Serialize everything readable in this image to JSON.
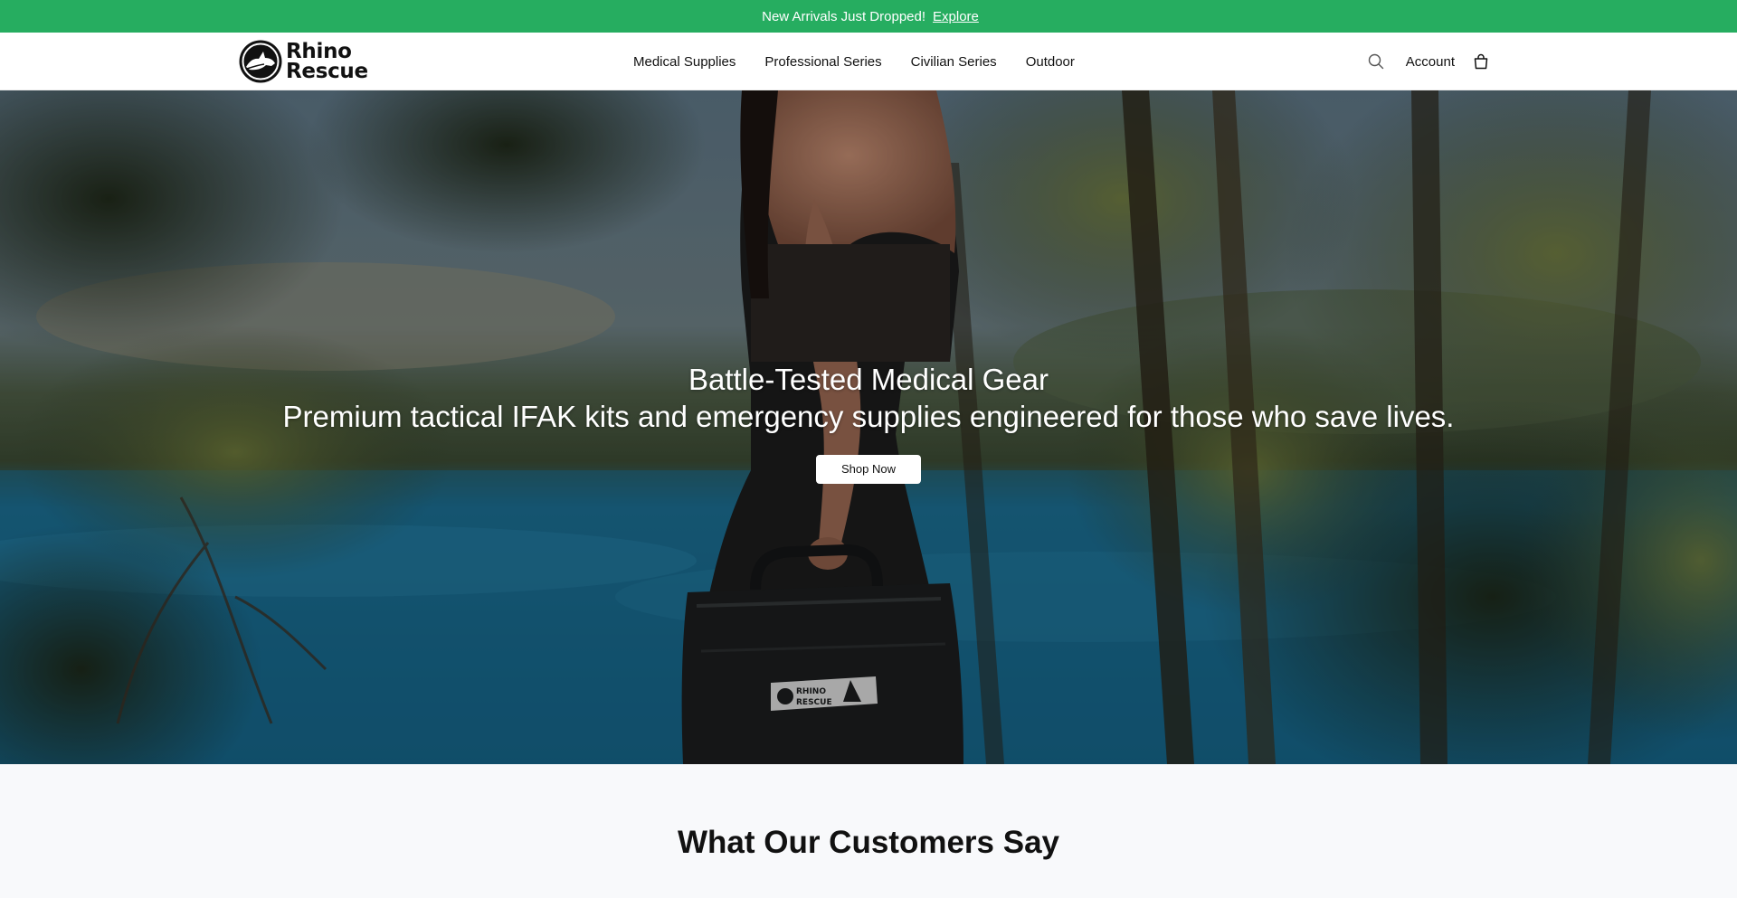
{
  "announcement": {
    "icon": "megaphone-icon",
    "icon_glyph": "",
    "text": "New Arrivals Just Dropped!",
    "link_label": "Explore",
    "close_icon": "close-icon",
    "close_glyph": "",
    "background_color": "#26ad60"
  },
  "header": {
    "logo": {
      "line1": "Rhino",
      "line2": "Rescue"
    },
    "nav": [
      {
        "label": "Medical Supplies"
      },
      {
        "label": "Professional Series"
      },
      {
        "label": "Civilian Series"
      },
      {
        "label": "Outdoor"
      }
    ],
    "search_icon": "search-icon",
    "account_label": "Account",
    "cart_icon": "shopping-bag-icon"
  },
  "hero": {
    "title": "Battle-Tested Medical Gear",
    "subtitle": "Premium tactical IFAK kits and emergency supplies engineered for those who save lives.",
    "button_label": "Shop Now",
    "case_label_line1": "RHINO",
    "case_label_line2": "RESCUE"
  },
  "testimonials": {
    "heading": "What Our Customers Say"
  }
}
